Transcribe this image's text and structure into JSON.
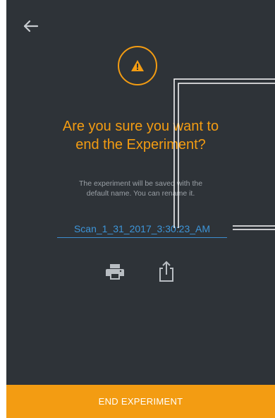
{
  "app": {
    "accent_color": "#f39c12",
    "background_color": "#2e3338",
    "link_color": "#3d95d9"
  },
  "header": {
    "back_icon": "arrow-left-icon"
  },
  "dialog": {
    "warning_icon": "warning-triangle-icon",
    "title": "Are you sure you want to\nend the Experiment?",
    "message": "The experiment will be saved with the\ndefault name. You can rename it.",
    "experiment_name": "Scan_1_31_2017_3:30:23_AM"
  },
  "actions": {
    "print_icon": "printer-icon",
    "share_icon": "share-icon",
    "end_label": "END EXPERIMENT"
  }
}
